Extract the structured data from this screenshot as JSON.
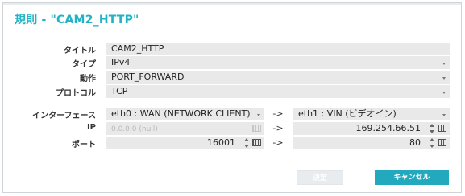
{
  "dialog": {
    "title": "規則 - \"CAM2_HTTP\""
  },
  "form": {
    "title_label": "タイトル",
    "title_value": "CAM2_HTTP",
    "type_label": "タイプ",
    "type_value": "IPv4",
    "action_label": "動作",
    "action_value": "PORT_FORWARD",
    "protocol_label": "プロトコル",
    "protocol_value": "TCP"
  },
  "mapping": {
    "interface_label": "インターフェース",
    "src_interface": "eth0 : WAN (NETWORK CLIENT)",
    "dst_interface": "eth1 : VIN (ビデオイン)",
    "ip_label": "IP",
    "src_ip": "0.0.0.0 (null)",
    "dst_ip": "169.254.66.51",
    "port_label": "ポート",
    "src_port": "16001",
    "dst_port": "80",
    "arrow": "->"
  },
  "buttons": {
    "ok_label": "決定",
    "cancel_label": "キャンセル"
  }
}
